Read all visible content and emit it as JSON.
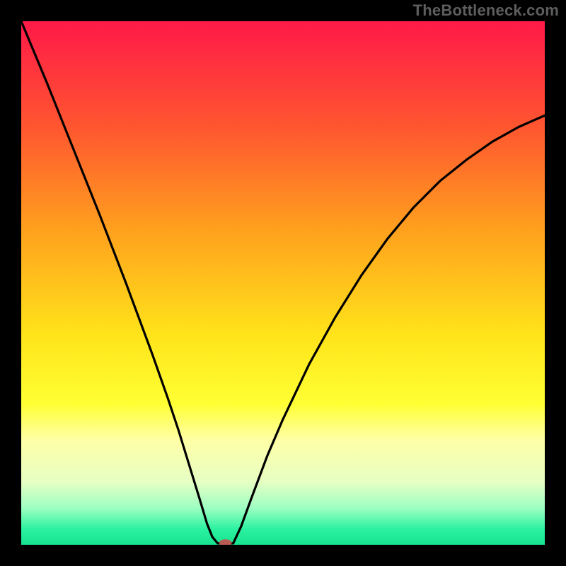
{
  "watermark": "TheBottleneck.com",
  "chart_data": {
    "type": "line",
    "title": "",
    "xlabel": "",
    "ylabel": "",
    "xlim": [
      0,
      100
    ],
    "ylim": [
      0,
      100
    ],
    "grid": false,
    "legend": false,
    "gradient_stops": [
      {
        "offset": 0,
        "color": "#ff1948"
      },
      {
        "offset": 20,
        "color": "#ff5530"
      },
      {
        "offset": 40,
        "color": "#ffa11d"
      },
      {
        "offset": 60,
        "color": "#ffe41a"
      },
      {
        "offset": 73,
        "color": "#ffff33"
      },
      {
        "offset": 80,
        "color": "#ffffa7"
      },
      {
        "offset": 88,
        "color": "#e6ffc3"
      },
      {
        "offset": 93,
        "color": "#9dffc3"
      },
      {
        "offset": 97,
        "color": "#2bf2a0"
      },
      {
        "offset": 100,
        "color": "#18e28f"
      }
    ],
    "series": [
      {
        "name": "left-branch",
        "x": [
          0,
          5,
          10,
          15,
          20,
          25,
          28,
          30,
          32,
          34,
          35.5,
          36.5,
          37.5
        ],
        "values": [
          100,
          88,
          75.5,
          63,
          50,
          36.5,
          28,
          22,
          15.5,
          9,
          4,
          1.5,
          0.3
        ]
      },
      {
        "name": "right-branch",
        "x": [
          40.5,
          42,
          44,
          47,
          50,
          55,
          60,
          65,
          70,
          75,
          80,
          85,
          90,
          95,
          100
        ],
        "values": [
          0.3,
          3.5,
          9,
          17,
          24,
          34.5,
          43.5,
          51.5,
          58.5,
          64.5,
          69.5,
          73.5,
          77,
          79.8,
          82
        ]
      },
      {
        "name": "valley-flat",
        "x": [
          37.5,
          38.3,
          39.2,
          40.0,
          40.5
        ],
        "values": [
          0.3,
          0.25,
          0.25,
          0.25,
          0.3
        ]
      }
    ],
    "marker": {
      "name": "bottleneck-point",
      "x": 39,
      "y": 0.35,
      "rx": 1.2,
      "ry": 0.7,
      "color": "#b95b54"
    }
  }
}
